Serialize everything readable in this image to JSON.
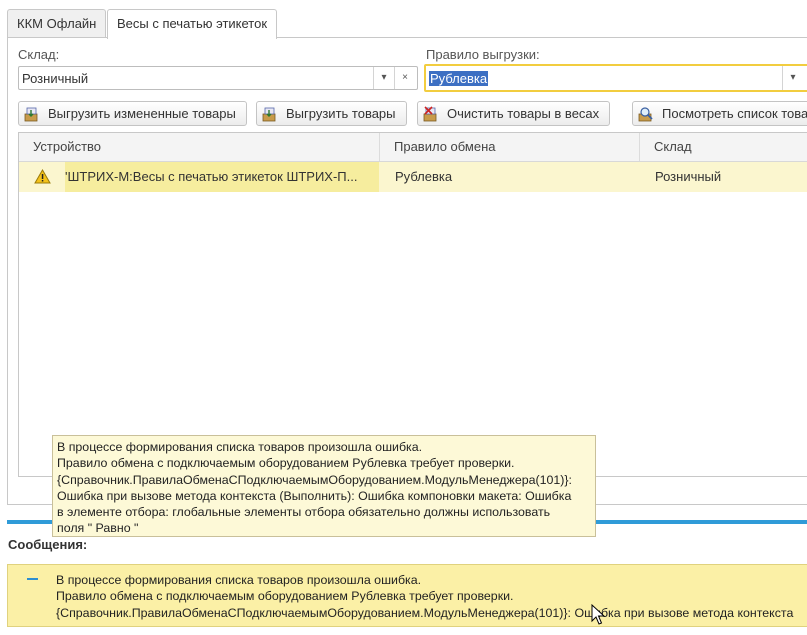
{
  "tabs": [
    {
      "label": "ККМ Офлайн",
      "active": false
    },
    {
      "label": "Весы с печатью этикеток",
      "active": true
    }
  ],
  "warehouse": {
    "label": "Склад:",
    "value": "Розничный"
  },
  "upload_rule": {
    "label": "Правило выгрузки:",
    "value": "Рублевка"
  },
  "toolbar": {
    "upload_changed": "Выгрузить измененные товары",
    "upload_goods": "Выгрузить товары",
    "clear_goods": "Очистить товары в весах",
    "view_list": "Посмотреть список товаров"
  },
  "table": {
    "columns": [
      "Устройство",
      "Правило обмена",
      "Склад"
    ],
    "rows": [
      {
        "device": "'ШТРИХ-М:Весы с печатью этикеток ШТРИХ-П...",
        "rule": "Рублевка",
        "warehouse": "Розничный",
        "warning": true
      }
    ]
  },
  "tooltip": {
    "lines": [
      "В процессе формирования списка товаров произошла ошибка.",
      "Правило обмена с подключаемым оборудованием Рублевка требует проверки.",
      "{Справочник.ПравилаОбменаСПодключаемымОборудованием.МодульМенеджера(101)}:",
      "Ошибка при вызове метода контекста (Выполнить): Ошибка компоновки макета: Ошибка",
      "в элементе отбора: глобальные элементы отбора обязательно должны использовать",
      "поля \" Равно \""
    ]
  },
  "messages": {
    "title": "Сообщения:",
    "lines": [
      "В процессе формирования списка товаров произошла ошибка.",
      "Правило обмена с подключаемым оборудованием Рублевка требует проверки.",
      "{Справочник.ПравилаОбменаСПодключаемымОборудованием.МодульМенеджера(101)}: Ошибка при вызове метода контекста"
    ]
  },
  "colors": {
    "accent": "#2f9bd8",
    "row_highlight": "#fbf6cf",
    "message_bg": "#fbf0a6",
    "focus": "#f2cd3f"
  }
}
